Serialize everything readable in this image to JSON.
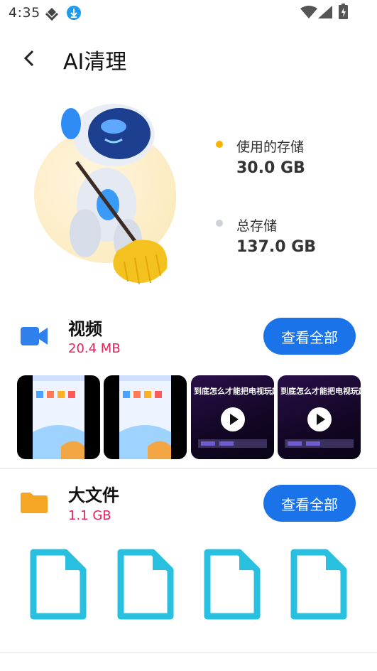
{
  "status_bar": {
    "time": "4:35"
  },
  "app_bar": {
    "title": "AI清理"
  },
  "storage": {
    "used_label": "使用的存储",
    "used_value": "30.0 GB",
    "total_label": "总存储",
    "total_value": "137.0 GB",
    "used_dot_color": "#f5b400",
    "total_dot_color": "#cfd3d8"
  },
  "sections": [
    {
      "title": "视频",
      "size": "20.4 MB",
      "button_label": "查看全部",
      "thumbnails": [
        {
          "kind": "phone-screen"
        },
        {
          "kind": "phone-screen"
        },
        {
          "kind": "video",
          "caption": "到底怎么才能把电视玩起来"
        },
        {
          "kind": "video",
          "caption": "到底怎么才能把电视玩起来"
        }
      ]
    },
    {
      "title": "大文件",
      "size": "1.1 GB",
      "button_label": "查看全部",
      "files": [
        "file",
        "file",
        "file",
        "file"
      ]
    }
  ],
  "colors": {
    "accent": "#1a73e8",
    "size_text": "#e3245a",
    "video_icon": "#2f80ed",
    "folder_icon": "#f5a623",
    "file_icon": "#29c0e0"
  }
}
